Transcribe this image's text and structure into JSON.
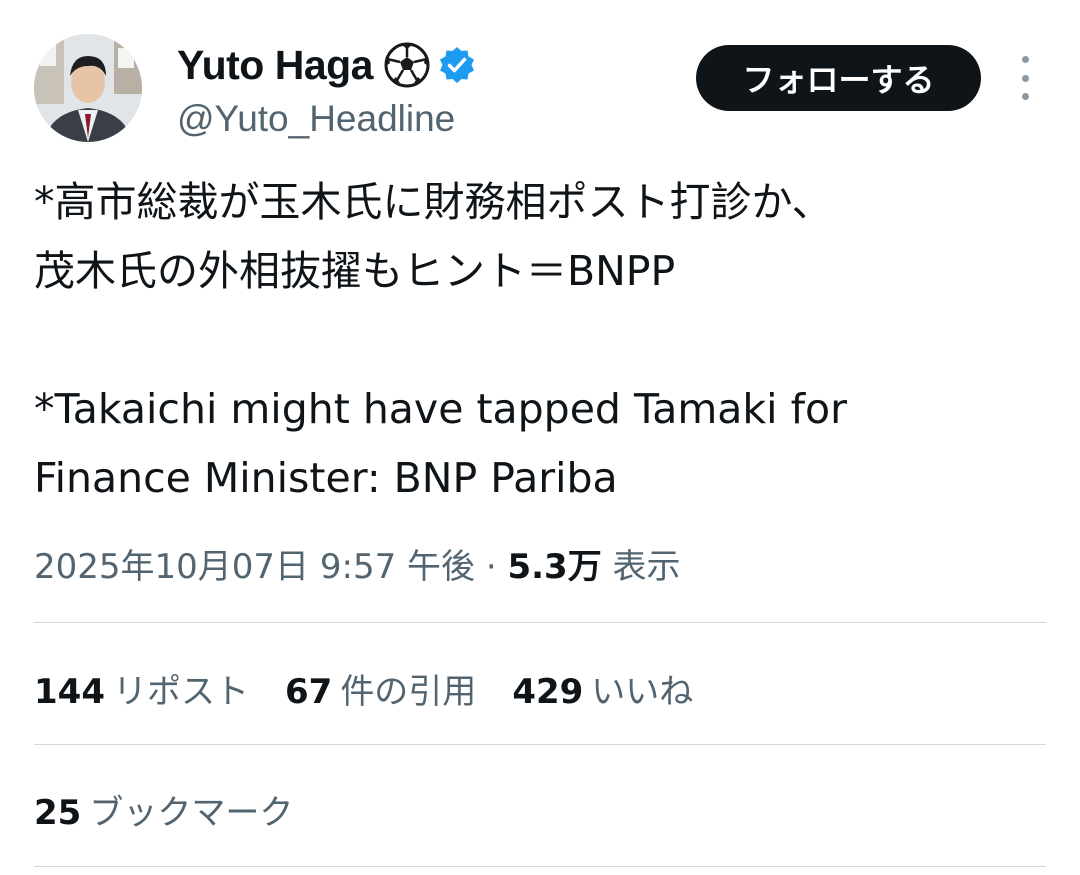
{
  "user": {
    "display_name": "Yuto Haga",
    "handle": "@Yuto_Headline",
    "emoji_icon": "soccer-ball-icon",
    "verified_icon": "verified-badge-icon",
    "verified_color": "#1d9bf0"
  },
  "actions": {
    "follow_label": "フォローする",
    "more_icon": "more-vertical-icon"
  },
  "tweet": {
    "text_lines_jp": [
      "*高市総裁が玉木氏に財務相ポスト打診か、",
      "茂木氏の外相抜擢もヒント＝BNPP"
    ],
    "text_lines_en": [
      "*Takaichi might have tapped Tamaki for",
      "Finance Minister: BNP Pariba"
    ]
  },
  "meta": {
    "timestamp": "2025年10月07日 9:57 午後",
    "separator": "·",
    "views_count": "5.3万",
    "views_label": "表示"
  },
  "stats": {
    "reposts": {
      "count": "144",
      "label": "リポスト"
    },
    "quotes": {
      "count": "67",
      "label": "件の引用"
    },
    "likes": {
      "count": "429",
      "label": "いいね"
    },
    "bookmarks": {
      "count": "25",
      "label": "ブックマーク"
    }
  },
  "colors": {
    "primary_text": "#0f1419",
    "secondary_text": "#536471",
    "divider": "#cfd9de",
    "button_bg": "#0f1419"
  }
}
